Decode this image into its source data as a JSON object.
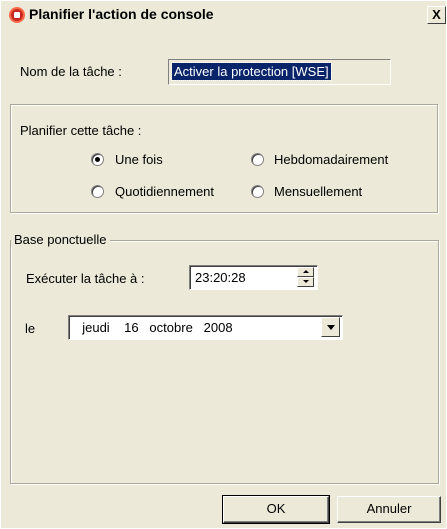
{
  "window": {
    "title": "Planifier l'action de console",
    "close_label": "X",
    "app_icon": "console-app-icon",
    "close_icon": "close-icon"
  },
  "task_name": {
    "label": "Nom de la tâche :",
    "value": "Activer la protection [WSE]"
  },
  "schedule": {
    "legend": "Planifier cette tâche :",
    "options": [
      {
        "label": "Une fois",
        "checked": true
      },
      {
        "label": "Hebdomadairement",
        "checked": false
      },
      {
        "label": "Quotidiennement",
        "checked": false
      },
      {
        "label": "Mensuellement",
        "checked": false
      }
    ]
  },
  "base": {
    "legend": "Base ponctuelle",
    "time_label": "Exécuter la tâche à :",
    "time_value": "23:20:28",
    "date_label": "le",
    "date_value": "  jeudi    16   octobre   2008"
  },
  "buttons": {
    "ok": "OK",
    "cancel": "Annuler"
  }
}
